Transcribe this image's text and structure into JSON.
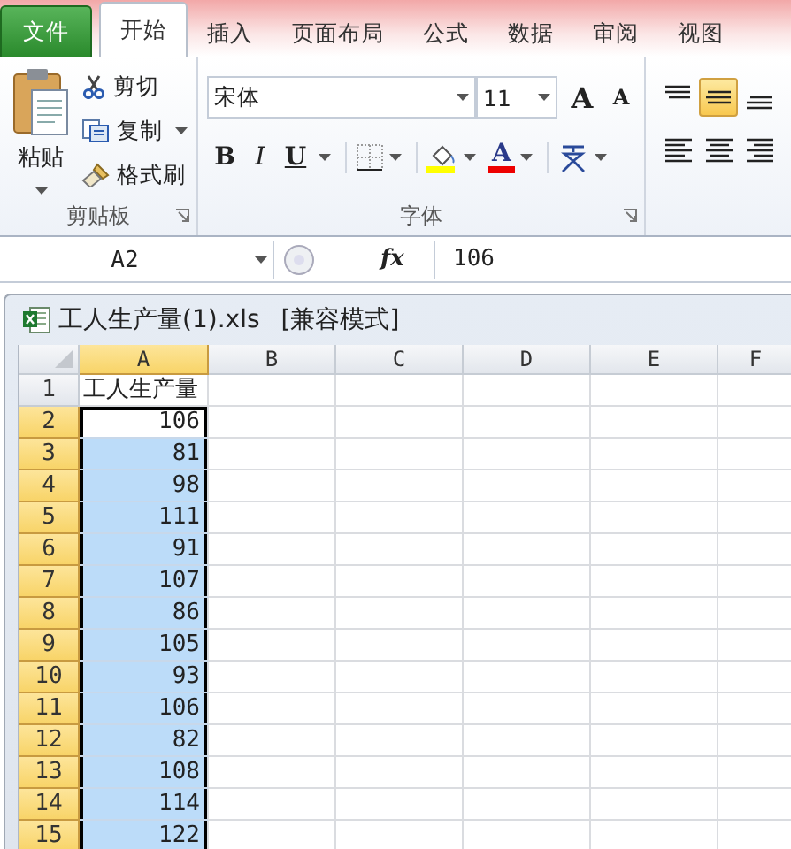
{
  "ribbon_tabs": [
    {
      "label": "文件",
      "kind": "file",
      "selected": false
    },
    {
      "label": "开始",
      "kind": "tab",
      "selected": true
    },
    {
      "label": "插入",
      "kind": "tab",
      "selected": false
    },
    {
      "label": "页面布局",
      "kind": "tab",
      "selected": false
    },
    {
      "label": "公式",
      "kind": "tab",
      "selected": false
    },
    {
      "label": "数据",
      "kind": "tab",
      "selected": false
    },
    {
      "label": "审阅",
      "kind": "tab",
      "selected": false
    },
    {
      "label": "视图",
      "kind": "tab",
      "selected": false
    }
  ],
  "ribbon": {
    "clipboard": {
      "paste": "粘贴",
      "cut": "剪切",
      "copy": "复制",
      "format_painter": "格式刷",
      "label": "剪贴板"
    },
    "font": {
      "font_name": "宋体",
      "font_size": "11",
      "grow": "A",
      "shrink": "A",
      "bold": "B",
      "italic": "I",
      "underline": "U",
      "font_color": "A",
      "label": "字体"
    },
    "alignment": [
      {
        "kind": "top",
        "selected": false
      },
      {
        "kind": "middle",
        "selected": true
      },
      {
        "kind": "bottom",
        "selected": false
      },
      {
        "kind": "left",
        "selected": false
      },
      {
        "kind": "center",
        "selected": false
      },
      {
        "kind": "right",
        "selected": false
      }
    ]
  },
  "formula_bar": {
    "name_box": "A2",
    "fx": "fx",
    "value": "106"
  },
  "workbook": {
    "title": "工人生产量(1).xls",
    "mode": "[兼容模式]"
  },
  "sheet": {
    "columns": [
      {
        "label": "A",
        "selected": true
      },
      {
        "label": "B",
        "selected": false
      },
      {
        "label": "C",
        "selected": false
      },
      {
        "label": "D",
        "selected": false
      },
      {
        "label": "E",
        "selected": false
      },
      {
        "label": "F",
        "selected": false
      }
    ],
    "rows": [
      {
        "number": "1",
        "selected": false,
        "active": false,
        "kind": "text",
        "value": "工人生产量"
      },
      {
        "number": "2",
        "selected": true,
        "active": true,
        "kind": "number",
        "value": "106"
      },
      {
        "number": "3",
        "selected": true,
        "active": false,
        "kind": "number",
        "value": "81"
      },
      {
        "number": "4",
        "selected": true,
        "active": false,
        "kind": "number",
        "value": "98"
      },
      {
        "number": "5",
        "selected": true,
        "active": false,
        "kind": "number",
        "value": "111"
      },
      {
        "number": "6",
        "selected": true,
        "active": false,
        "kind": "number",
        "value": "91"
      },
      {
        "number": "7",
        "selected": true,
        "active": false,
        "kind": "number",
        "value": "107"
      },
      {
        "number": "8",
        "selected": true,
        "active": false,
        "kind": "number",
        "value": "86"
      },
      {
        "number": "9",
        "selected": true,
        "active": false,
        "kind": "number",
        "value": "105"
      },
      {
        "number": "10",
        "selected": true,
        "active": false,
        "kind": "number",
        "value": "93"
      },
      {
        "number": "11",
        "selected": true,
        "active": false,
        "kind": "number",
        "value": "106"
      },
      {
        "number": "12",
        "selected": true,
        "active": false,
        "kind": "number",
        "value": "82"
      },
      {
        "number": "13",
        "selected": true,
        "active": false,
        "kind": "number",
        "value": "108"
      },
      {
        "number": "14",
        "selected": true,
        "active": false,
        "kind": "number",
        "value": "114"
      },
      {
        "number": "15",
        "selected": true,
        "active": false,
        "kind": "number",
        "value": "122"
      }
    ]
  }
}
